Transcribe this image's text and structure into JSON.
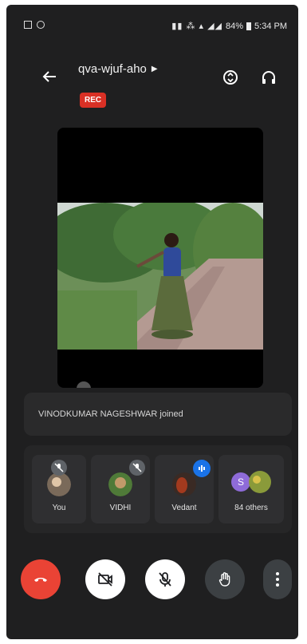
{
  "status_bar": {
    "battery": "84%",
    "time": "5:34 PM"
  },
  "header": {
    "meeting_code": "qva-wjuf-aho",
    "rec_label": "REC"
  },
  "notice": {
    "text": "VINODKUMAR NAGESHWAR joined"
  },
  "participants": [
    {
      "name": "You"
    },
    {
      "name": "VIDHI"
    },
    {
      "name": "Vedant"
    },
    {
      "name": "84 others",
      "avatar_letter": "S"
    }
  ],
  "colors": {
    "end_call": "#ea4335",
    "rec": "#d93025",
    "speaking": "#1a73e8",
    "avatar_purple": "#8e6bd8"
  }
}
